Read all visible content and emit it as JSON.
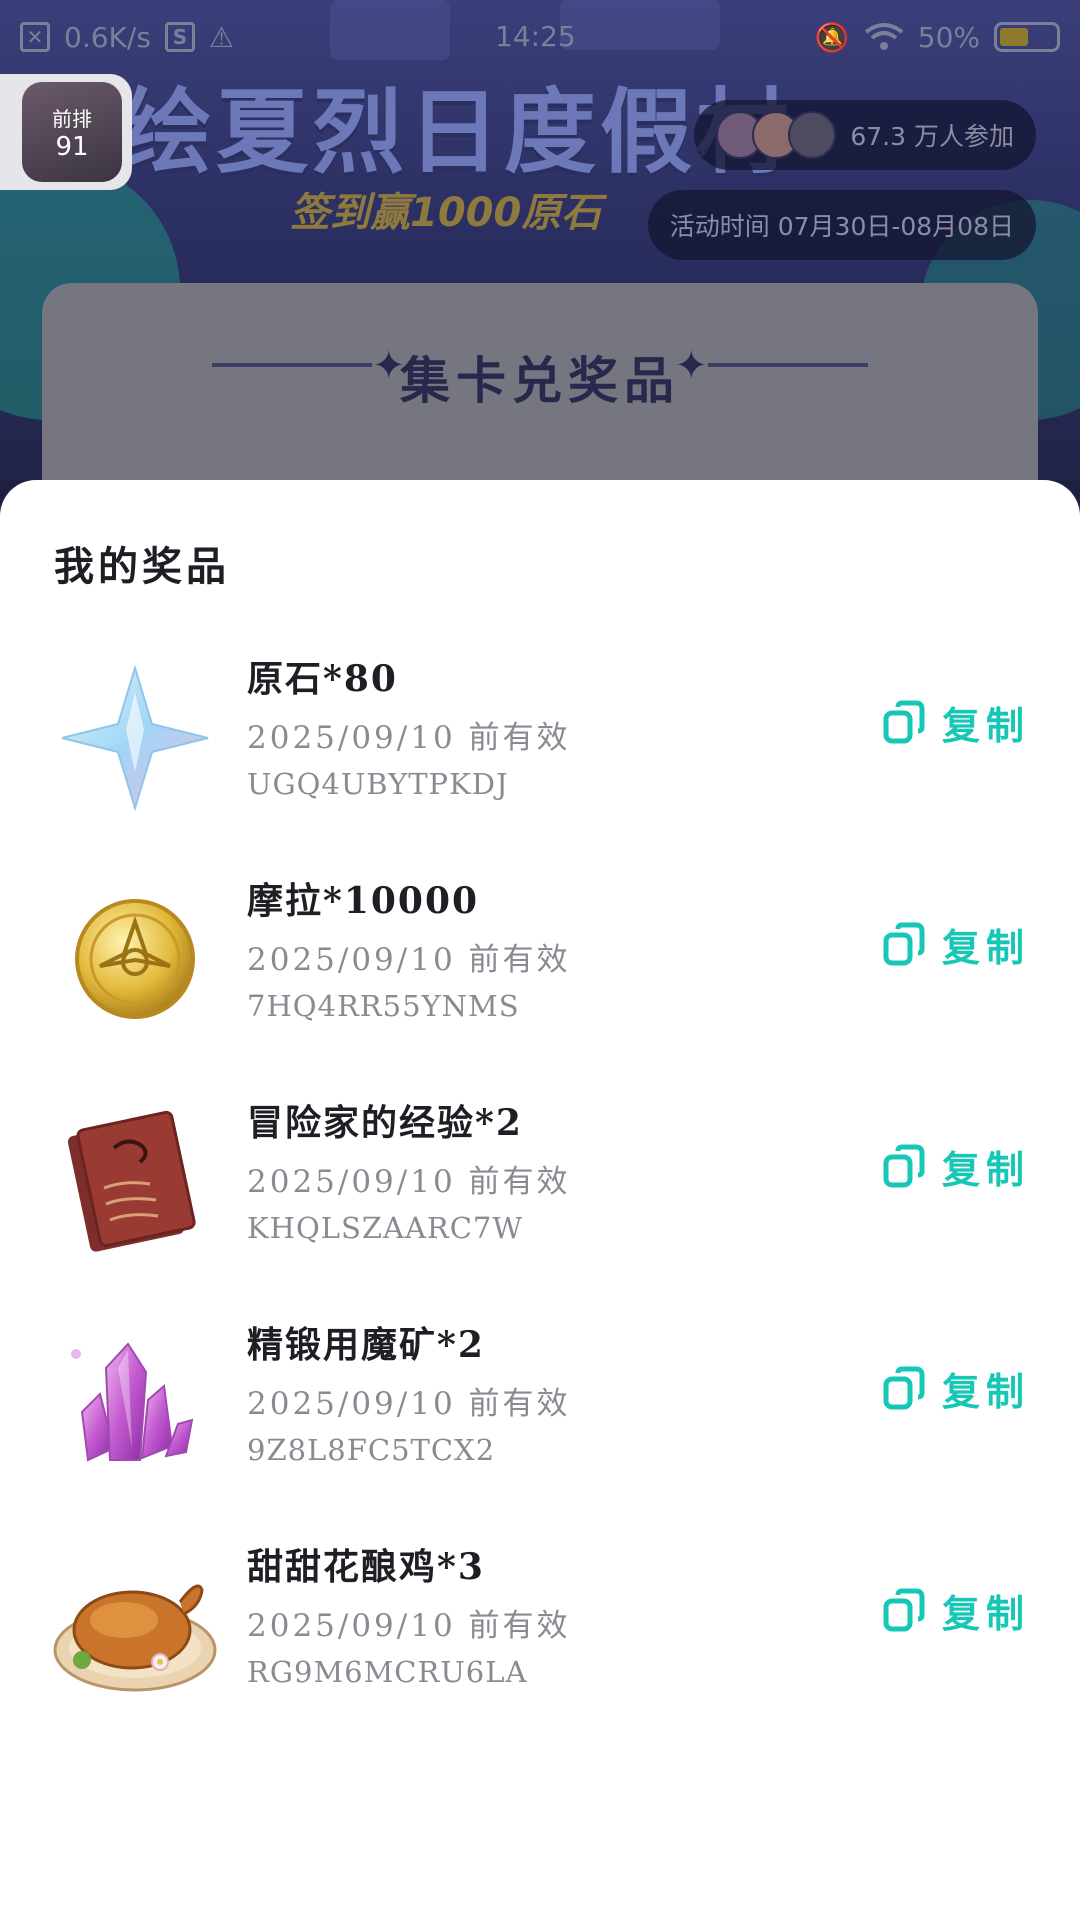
{
  "status_bar": {
    "net_speed": "0.6K/s",
    "time": "14:25",
    "battery": "50%"
  },
  "float_badge": {
    "line1": "前排",
    "line2": "91"
  },
  "banner": {
    "title": "绘夏烈日度假村",
    "subtitle": "签到赢1000原石",
    "participants": "67.3 万人参加",
    "event_time": "活动时间 07月30日-08月08日"
  },
  "background_card": {
    "title": "集卡兑奖品"
  },
  "sheet": {
    "title": "我的奖品",
    "copy_label": "复制",
    "accent_color": "#17c7b6",
    "prizes": [
      {
        "name": "原石*80",
        "expiry": "2025/09/10 前有效",
        "code": "UGQ4UBYTPKDJ",
        "icon": "primogem-icon"
      },
      {
        "name": "摩拉*10000",
        "expiry": "2025/09/10 前有效",
        "code": "7HQ4RR55YNMS",
        "icon": "mora-coin-icon"
      },
      {
        "name": "冒险家的经验*2",
        "expiry": "2025/09/10 前有效",
        "code": "KHQLSZAARC7W",
        "icon": "adventurer-experience-book-icon"
      },
      {
        "name": "精锻用魔矿*2",
        "expiry": "2025/09/10 前有效",
        "code": "9Z8L8FC5TCX2",
        "icon": "mystic-enhancement-ore-icon"
      },
      {
        "name": "甜甜花酿鸡*3",
        "expiry": "2025/09/10 前有效",
        "code": "RG9M6MCRU6LA",
        "icon": "sweet-madame-dish-icon"
      }
    ]
  }
}
